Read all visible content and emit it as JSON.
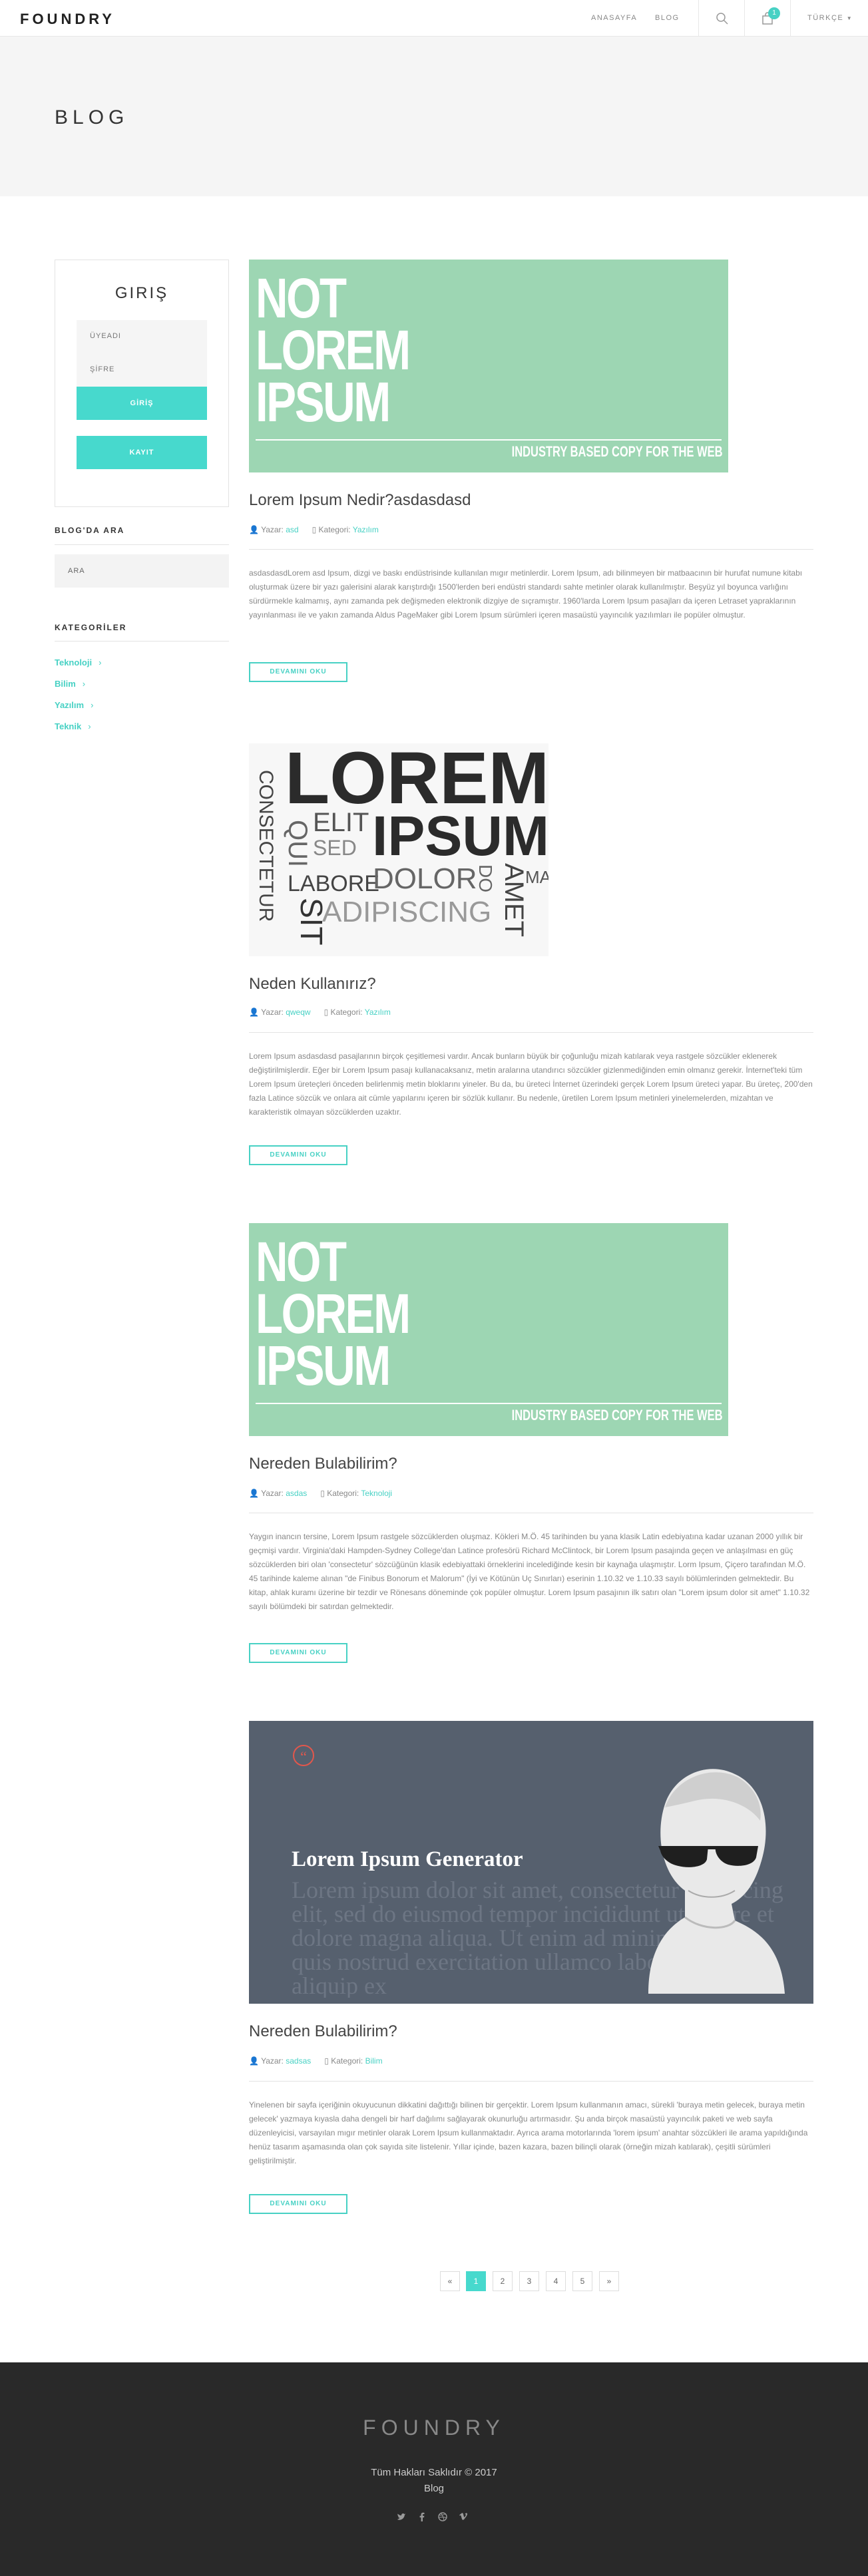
{
  "nav": {
    "logo": "FOUNDRY",
    "links": [
      "ANASAYFA",
      "BLOG"
    ],
    "cart_count": "1",
    "language": "TÜRKÇE"
  },
  "hero": {
    "title": "BLOG"
  },
  "sidebar": {
    "login": {
      "title": "GIRIŞ",
      "username": "ÜYEADI",
      "password": "ŞİFRE",
      "login_button": "GİRİŞ",
      "register_button": "KAYIT"
    },
    "search": {
      "heading": "BLOG'DA ARA",
      "placeholder": "ARA"
    },
    "categories": {
      "heading": "KATEGORİLER",
      "items": [
        "Teknoloji",
        "Bilim",
        "Yazılım",
        "Teknik"
      ]
    }
  },
  "posts": [
    {
      "title": "Lorem Ipsum Nedir?asdasdasd",
      "author_label": "Yazar:",
      "author": "asd",
      "category_label": "Kategori:",
      "category": "Yazılım",
      "excerpt": "asdasdasdLorem asd Ipsum, dizgi ve baskı endüstrisinde kullanılan mıgır metinlerdir. Lorem Ipsum, adı bilinmeyen bir matbaacının bir hurufat numune kitabı oluşturmak üzere bir yazı galerisini alarak karıştırdığı 1500'lerden beri endüstri standardı sahte metinler olarak kullanılmıştır. Beşyüz yıl boyunca varlığını sürdürmekle kalmamış, aynı zamanda pek değişmeden elektronik dizgiye de sıçramıştır. 1960'larda Lorem Ipsum pasajları da içeren Letraset yapraklarının yayınlanması ile ve yakın zamanda Aldus PageMaker gibi Lorem Ipsum sürümleri içeren masaüstü yayıncılık yazılımları ile popüler olmuştur.",
      "button": "DEVAMINI OKU",
      "image": {
        "line1": "NOT",
        "line2": "LOREM",
        "line3": "IPSUM",
        "tagline": "INDUSTRY BASED COPY FOR THE WEB"
      }
    },
    {
      "title": "Neden Kullanırız?",
      "author_label": "Yazar:",
      "author": "qweqw",
      "category_label": "Kategori:",
      "category": "Yazılım",
      "excerpt": "Lorem Ipsum asdasdasd pasajlarının birçok çeşitlemesi vardır. Ancak bunların büyük bir çoğunluğu mizah katılarak veya rastgele sözcükler eklenerek değiştirilmişlerdir. Eğer bir Lorem Ipsum pasajı kullanacaksanız, metin aralarına utandırıcı sözcükler gizlenmediğinden emin olmanız gerekir. İnternet'teki tüm Lorem Ipsum üreteçleri önceden belirlenmiş metin bloklarını yineler. Bu da, bu üreteci İnternet üzerindeki gerçek Lorem Ipsum üreteci yapar. Bu üreteç, 200'den fazla Latince sözcük ve onlara ait cümle yapılarını içeren bir sözlük kullanır. Bu nedenle, üretilen Lorem Ipsum metinleri yinelemelerden, mizahtan ve karakteristik olmayan sözcüklerden uzaktır.",
      "button": "DEVAMINI OKU",
      "image": {
        "words": [
          "LOREM",
          "IPSUM",
          "CONSECTETUR",
          "QUI",
          "ELIT",
          "SED",
          "LABORE",
          "DOLOR",
          "DO",
          "AMET",
          "ADIPISCING",
          "SIT",
          "MA"
        ]
      }
    },
    {
      "title": "Nereden Bulabilirim?",
      "author_label": "Yazar:",
      "author": "asdas",
      "category_label": "Kategori:",
      "category": "Teknoloji",
      "excerpt": "Yaygın inancın tersine, Lorem Ipsum rastgele sözcüklerden oluşmaz. Kökleri M.Ö. 45 tarihinden bu yana klasik Latin edebiyatına kadar uzanan 2000 yıllık bir geçmişi vardır. Virginia'daki Hampden-Sydney College'dan Latince profesörü Richard McClintock, bir Lorem Ipsum pasajında geçen ve anlaşılması en güç sözcüklerden biri olan 'consectetur' sözcüğünün klasik edebiyattaki örneklerini incelediğinde kesin bir kaynağa ulaşmıştır. Lorm Ipsum, Çiçero tarafından M.Ö. 45 tarihinde kaleme alınan \"de Finibus Bonorum et Malorum\" (İyi ve Kötünün Uç Sınırları) eserinin 1.10.32 ve 1.10.33 sayılı bölümlerinden gelmektedir. Bu kitap, ahlak kuramı üzerine bir tezdir ve Rönesans döneminde çok popüler olmuştur. Lorem Ipsum pasajının ilk satırı olan \"Lorem ipsum dolor sit amet\" 1.10.32 sayılı bölümdeki bir satırdan gelmektedir.",
      "button": "DEVAMINI OKU",
      "image": {
        "line1": "NOT",
        "line2": "LOREM",
        "line3": "IPSUM",
        "tagline": "INDUSTRY BASED COPY FOR THE WEB"
      }
    },
    {
      "title": "Nereden Bulabilirim?",
      "author_label": "Yazar:",
      "author": "sadsas",
      "category_label": "Kategori:",
      "category": "Bilim",
      "excerpt": "Yinelenen bir sayfa içeriğinin okuyucunun dikkatini dağıttığı bilinen bir gerçektir. Lorem Ipsum kullanmanın amacı, sürekli 'buraya metin gelecek, buraya metin gelecek' yazmaya kıyasla daha dengeli bir harf dağılımı sağlayarak okunurluğu artırmasıdır. Şu anda birçok masaüstü yayıncılık paketi ve web sayfa düzenleyicisi, varsayılan mıgır metinler olarak Lorem Ipsum kullanmaktadır. Ayrıca arama motorlarında 'lorem ipsum' anahtar sözcükleri ile arama yapıldığında henüz tasarım aşamasında olan çok sayıda site listelenir. Yıllar içinde, bazen kazara, bazen bilinçli olarak (örneğin mizah katılarak), çeşitli sürümleri geliştirilmiştir.",
      "button": "DEVAMINI OKU",
      "image": {
        "title": "Lorem Ipsum Generator",
        "body": "Lorem ipsum dolor sit amet, consectetur adipiscing elit, sed do eiusmod tempor incididunt ut labore et dolore magna aliqua. Ut enim ad minim veniam, quis nostrud exercitation ullamco laboris nisi ut aliquip ex"
      }
    }
  ],
  "pagination": {
    "prev": "«",
    "pages": [
      "1",
      "2",
      "3",
      "4",
      "5"
    ],
    "next": "»",
    "active": "1"
  },
  "footer": {
    "logo": "FOUNDRY",
    "copyright": "Tüm Hakları Saklıdır © 2017",
    "blog": "Blog",
    "social_icons": [
      "twitter-icon",
      "facebook-icon",
      "dribbble-icon",
      "vimeo-icon"
    ]
  },
  "colors": {
    "accent": "#47d1c4",
    "image_green": "#9dd6b3",
    "image_slate": "#56606e",
    "footer": "#292929"
  }
}
